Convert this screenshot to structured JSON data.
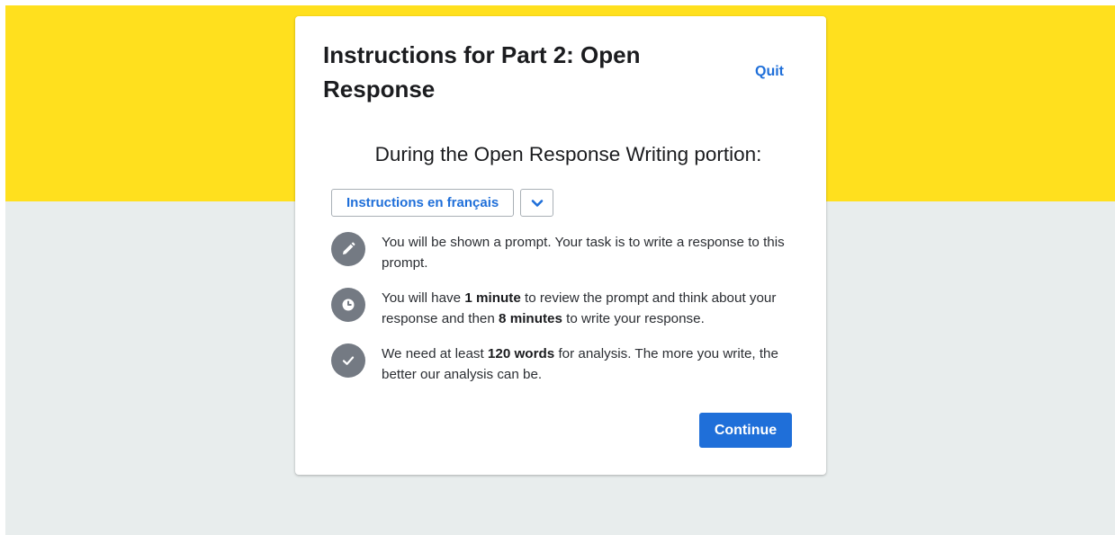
{
  "header": {
    "title": "Instructions for Part 2: Open Response",
    "quit_label": "Quit"
  },
  "subtitle": "During the Open Response Writing portion:",
  "language": {
    "button_label": "Instructions en français",
    "dropdown_icon": "chevron-down-icon"
  },
  "instructions": [
    {
      "icon": "pencil-icon",
      "parts": [
        "You will be shown a prompt. Your task is to write a response to this prompt."
      ]
    },
    {
      "icon": "clock-icon",
      "parts": [
        "You will have ",
        "1 minute",
        " to review the prompt and think about your response and then ",
        "8 minutes",
        " to write your response."
      ]
    },
    {
      "icon": "checkmark-icon",
      "parts": [
        "We need at least ",
        "120 words",
        " for analysis. The more you write, the better our analysis can be."
      ]
    }
  ],
  "footer": {
    "continue_label": "Continue"
  },
  "colors": {
    "accent": "#1f6fd9",
    "banner": "#ffe01e",
    "background": "#e8eded",
    "icon_bg": "#747a83"
  }
}
